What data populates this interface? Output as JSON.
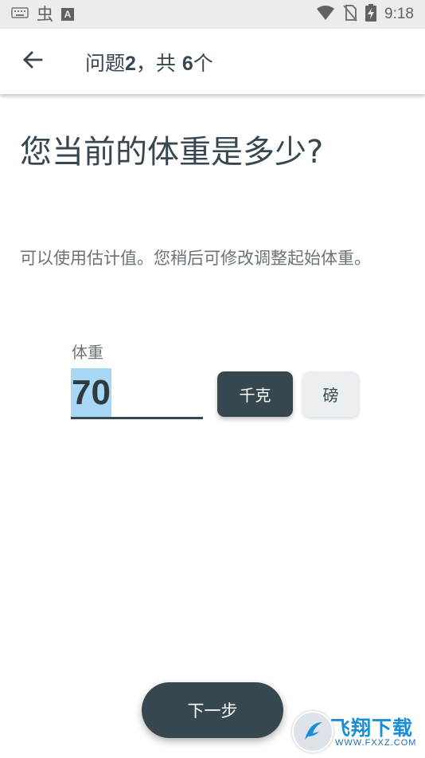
{
  "status_bar": {
    "left_icons": [
      "keyboard-icon",
      "bug-icon",
      "a-box-icon"
    ],
    "bug_glyph": "虫",
    "a_glyph": "A",
    "right_icons": [
      "wifi-icon",
      "no-sim-icon",
      "battery-charging-icon"
    ],
    "time": "9:18"
  },
  "app_bar": {
    "back_icon": "arrow-left-icon",
    "title_prefix": "问题",
    "current": "2",
    "title_middle": "，共 ",
    "total": "6",
    "title_suffix": "个"
  },
  "question": {
    "title": "您当前的体重是多少?",
    "hint": "可以使用估计值。您稍后可修改调整起始体重。"
  },
  "weight": {
    "label": "体重",
    "value": "70",
    "units": [
      {
        "label": "千克",
        "selected": true
      },
      {
        "label": "磅",
        "selected": false
      }
    ]
  },
  "footer": {
    "next_label": "下一步"
  },
  "watermark": {
    "text": "飞翔下载",
    "url": "WWW.FXXZ.COM"
  },
  "colors": {
    "primary": "#37474f",
    "selection": "#a6d7f5",
    "status_bar": "#ececec",
    "unselected_button": "#eceff1"
  }
}
